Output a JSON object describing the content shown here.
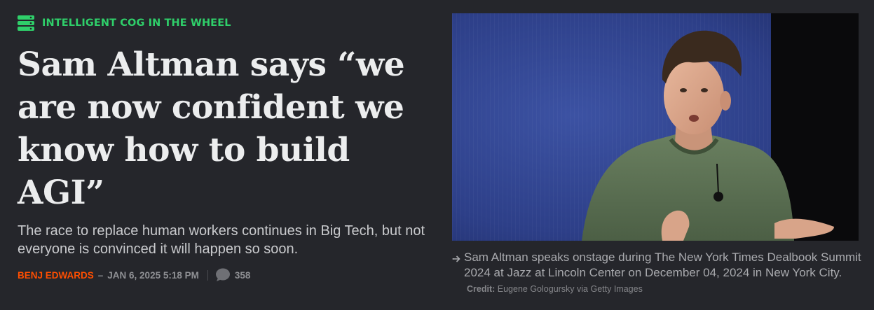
{
  "article": {
    "kicker": "INTELLIGENT COG IN THE WHEEL",
    "headline": "Sam Altman says “we are now confident we know how to build AGI”",
    "dek": "The race to replace human workers continues in Big Tech, but not everyone is convinced it will happen so soon.",
    "author": "BENJ EDWARDS",
    "separator": "–",
    "date": "JAN 6, 2025 5:18 PM",
    "comment_count": "358"
  },
  "photo": {
    "caption": "Sam Altman speaks onstage during The New York Times Dealbook Summit 2024 at Jazz at Lincoln Center on December 04, 2024 in New York City.",
    "credit_label": "Credit:",
    "credit": "Eugene Gologursky via Getty Images"
  },
  "colors": {
    "background": "#25262b",
    "kicker": "#2fcf6a",
    "author": "#ff4e00",
    "headline": "#ecedee",
    "muted": "#8f9094"
  },
  "icons": {
    "kicker": "stacked-servers-icon",
    "comments": "speech-bubble-icon",
    "caption": "arrow-pointer-icon"
  }
}
